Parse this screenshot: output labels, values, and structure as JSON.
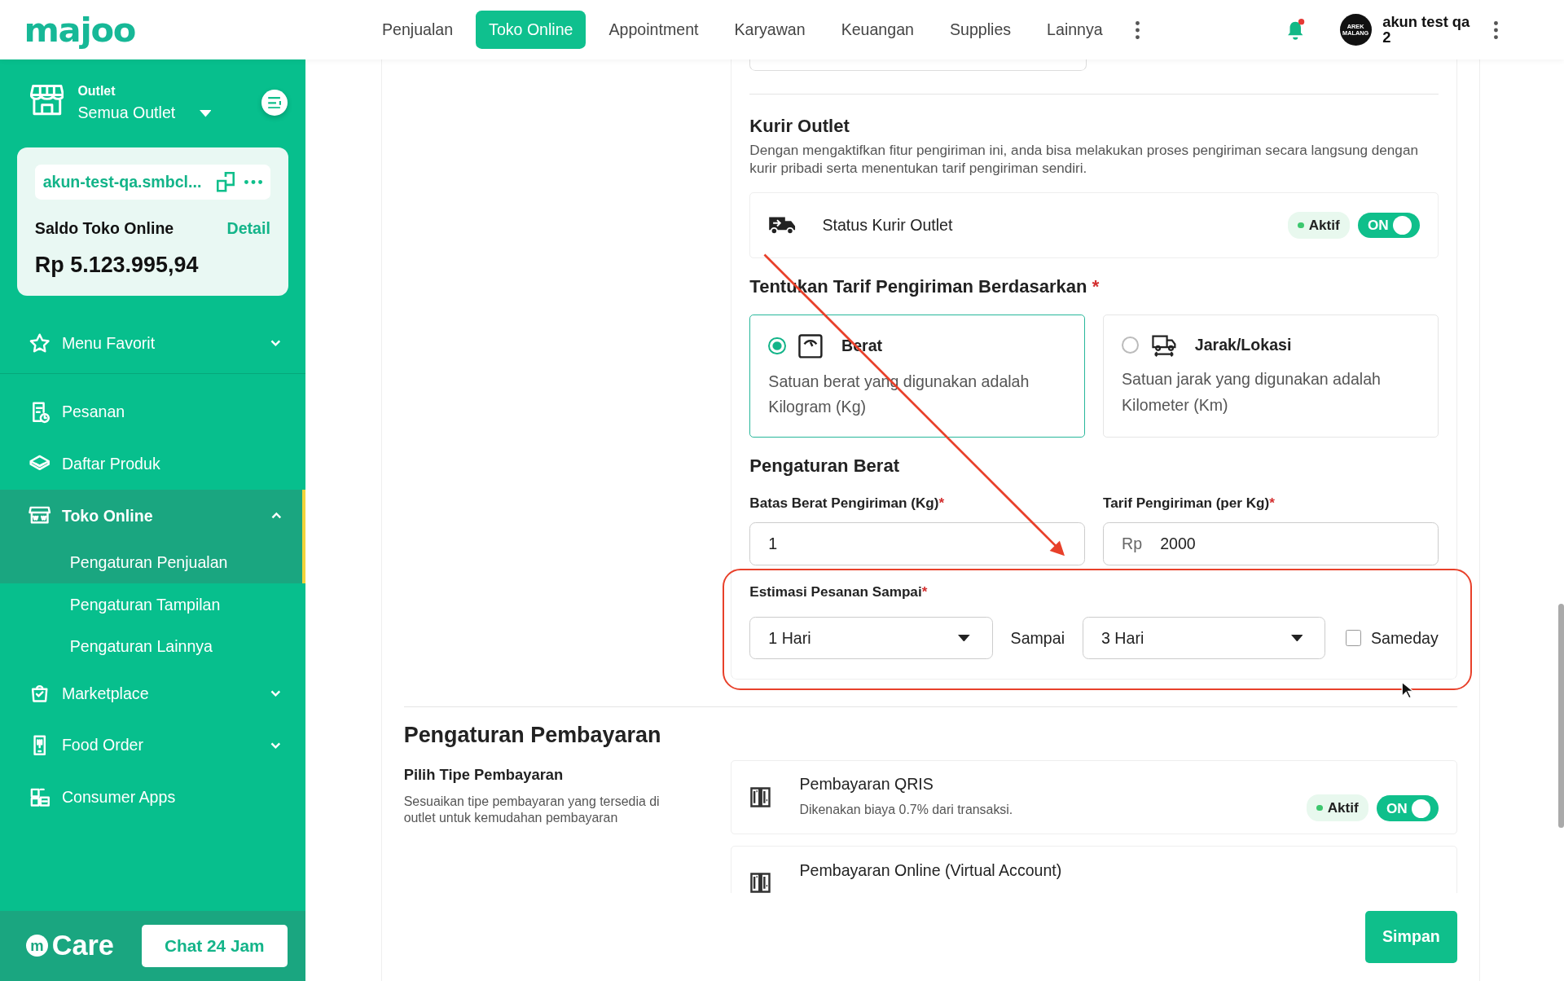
{
  "topbar": {
    "logo": "majoo",
    "nav": [
      {
        "label": "Penjualan",
        "selected": false
      },
      {
        "label": "Toko Online",
        "selected": true
      },
      {
        "label": "Appointment",
        "selected": false
      },
      {
        "label": "Karyawan",
        "selected": false
      },
      {
        "label": "Keuangan",
        "selected": false
      },
      {
        "label": "Supplies",
        "selected": false
      },
      {
        "label": "Lainnya",
        "selected": false
      }
    ],
    "has_notification": true,
    "user": {
      "avatar_text": "AREK MALANG",
      "name": "akun test qa 2"
    }
  },
  "sidebar": {
    "outlet": {
      "label": "Outlet",
      "value": "Semua Outlet"
    },
    "store_card": {
      "url": "akun-test-qa.smbcl...",
      "balance_label": "Saldo Toko Online",
      "detail_link": "Detail",
      "balance": "Rp 5.123.995,94"
    },
    "items": [
      {
        "kind": "group",
        "label": "Menu Favorit",
        "expanded": false,
        "selected": false
      },
      {
        "kind": "link",
        "label": "Pesanan",
        "selected": false
      },
      {
        "kind": "link",
        "label": "Daftar Produk",
        "selected": false
      },
      {
        "kind": "group",
        "label": "Toko Online",
        "expanded": true,
        "selected": true,
        "children": [
          {
            "label": "Pengaturan Penjualan",
            "selected": true
          },
          {
            "label": "Pengaturan Tampilan",
            "selected": false
          },
          {
            "label": "Pengaturan Lainnya",
            "selected": false
          }
        ]
      },
      {
        "kind": "group",
        "label": "Marketplace",
        "expanded": false,
        "selected": false
      },
      {
        "kind": "group",
        "label": "Food Order",
        "expanded": false,
        "selected": false
      },
      {
        "kind": "link",
        "label": "Consumer Apps",
        "selected": false
      }
    ],
    "care": {
      "mark": "m",
      "logo_text": "Care",
      "button": "Chat 24 Jam"
    }
  },
  "shipping": {
    "kurir": {
      "title": "Kurir Outlet",
      "description": "Dengan mengaktifkan fitur pengiriman ini, anda bisa melakukan proses pengiriman secara langsung dengan kurir pribadi serta menentukan tarif pengiriman sendiri.",
      "status": {
        "label": "Status Kurir Outlet",
        "badge": "Aktif",
        "toggle_label": "ON",
        "on": true
      }
    },
    "tarif": {
      "title": "Tentukan Tarif Pengiriman Berdasarkan",
      "required_mark": "*",
      "options": [
        {
          "title": "Berat",
          "description": "Satuan berat yang digunakan adalah Kilogram (Kg)",
          "selected": true
        },
        {
          "title": "Jarak/Lokasi",
          "description": "Satuan jarak yang digunakan adalah Kilometer (Km)",
          "selected": false
        }
      ]
    },
    "berat": {
      "title": "Pengaturan Berat",
      "fields": [
        {
          "label": "Batas Berat Pengiriman (Kg)",
          "required_mark": "*",
          "value": "1"
        },
        {
          "label": "Tarif Pengiriman (per Kg)",
          "required_mark": "*",
          "prefix": "Rp",
          "value": "2000"
        }
      ]
    },
    "estimasi": {
      "label": "Estimasi Pesanan Sampai",
      "required_mark": "*",
      "from": "1 Hari",
      "separator": "Sampai",
      "to": "3 Hari",
      "sameday": {
        "label": "Sameday",
        "checked": false
      }
    }
  },
  "payment": {
    "title": "Pengaturan Pembayaran",
    "subtitle": "Pilih Tipe Pembayaran",
    "description": "Sesuaikan tipe pembayaran yang tersedia di outlet untuk kemudahan pembayaran",
    "methods": [
      {
        "name": "Pembayaran QRIS",
        "description": "Dikenakan biaya 0.7% dari transaksi.",
        "badge": "Aktif",
        "toggle_label": "ON",
        "on": true
      },
      {
        "name": "Pembayaran Online (Virtual Account)"
      }
    ]
  },
  "save_button": "Simpan"
}
